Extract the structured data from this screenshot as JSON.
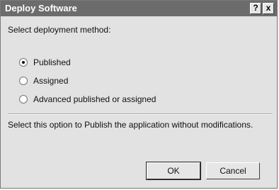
{
  "dialog": {
    "title": "Deploy Software",
    "help_glyph": "?",
    "close_glyph": "x",
    "prompt": "Select deployment method:",
    "options": [
      {
        "label": "Published",
        "selected": true
      },
      {
        "label": "Assigned",
        "selected": false
      },
      {
        "label": "Advanced published or assigned",
        "selected": false
      }
    ],
    "description": "Select this option to Publish the application without modifications.",
    "ok_label": "OK",
    "cancel_label": "Cancel"
  }
}
